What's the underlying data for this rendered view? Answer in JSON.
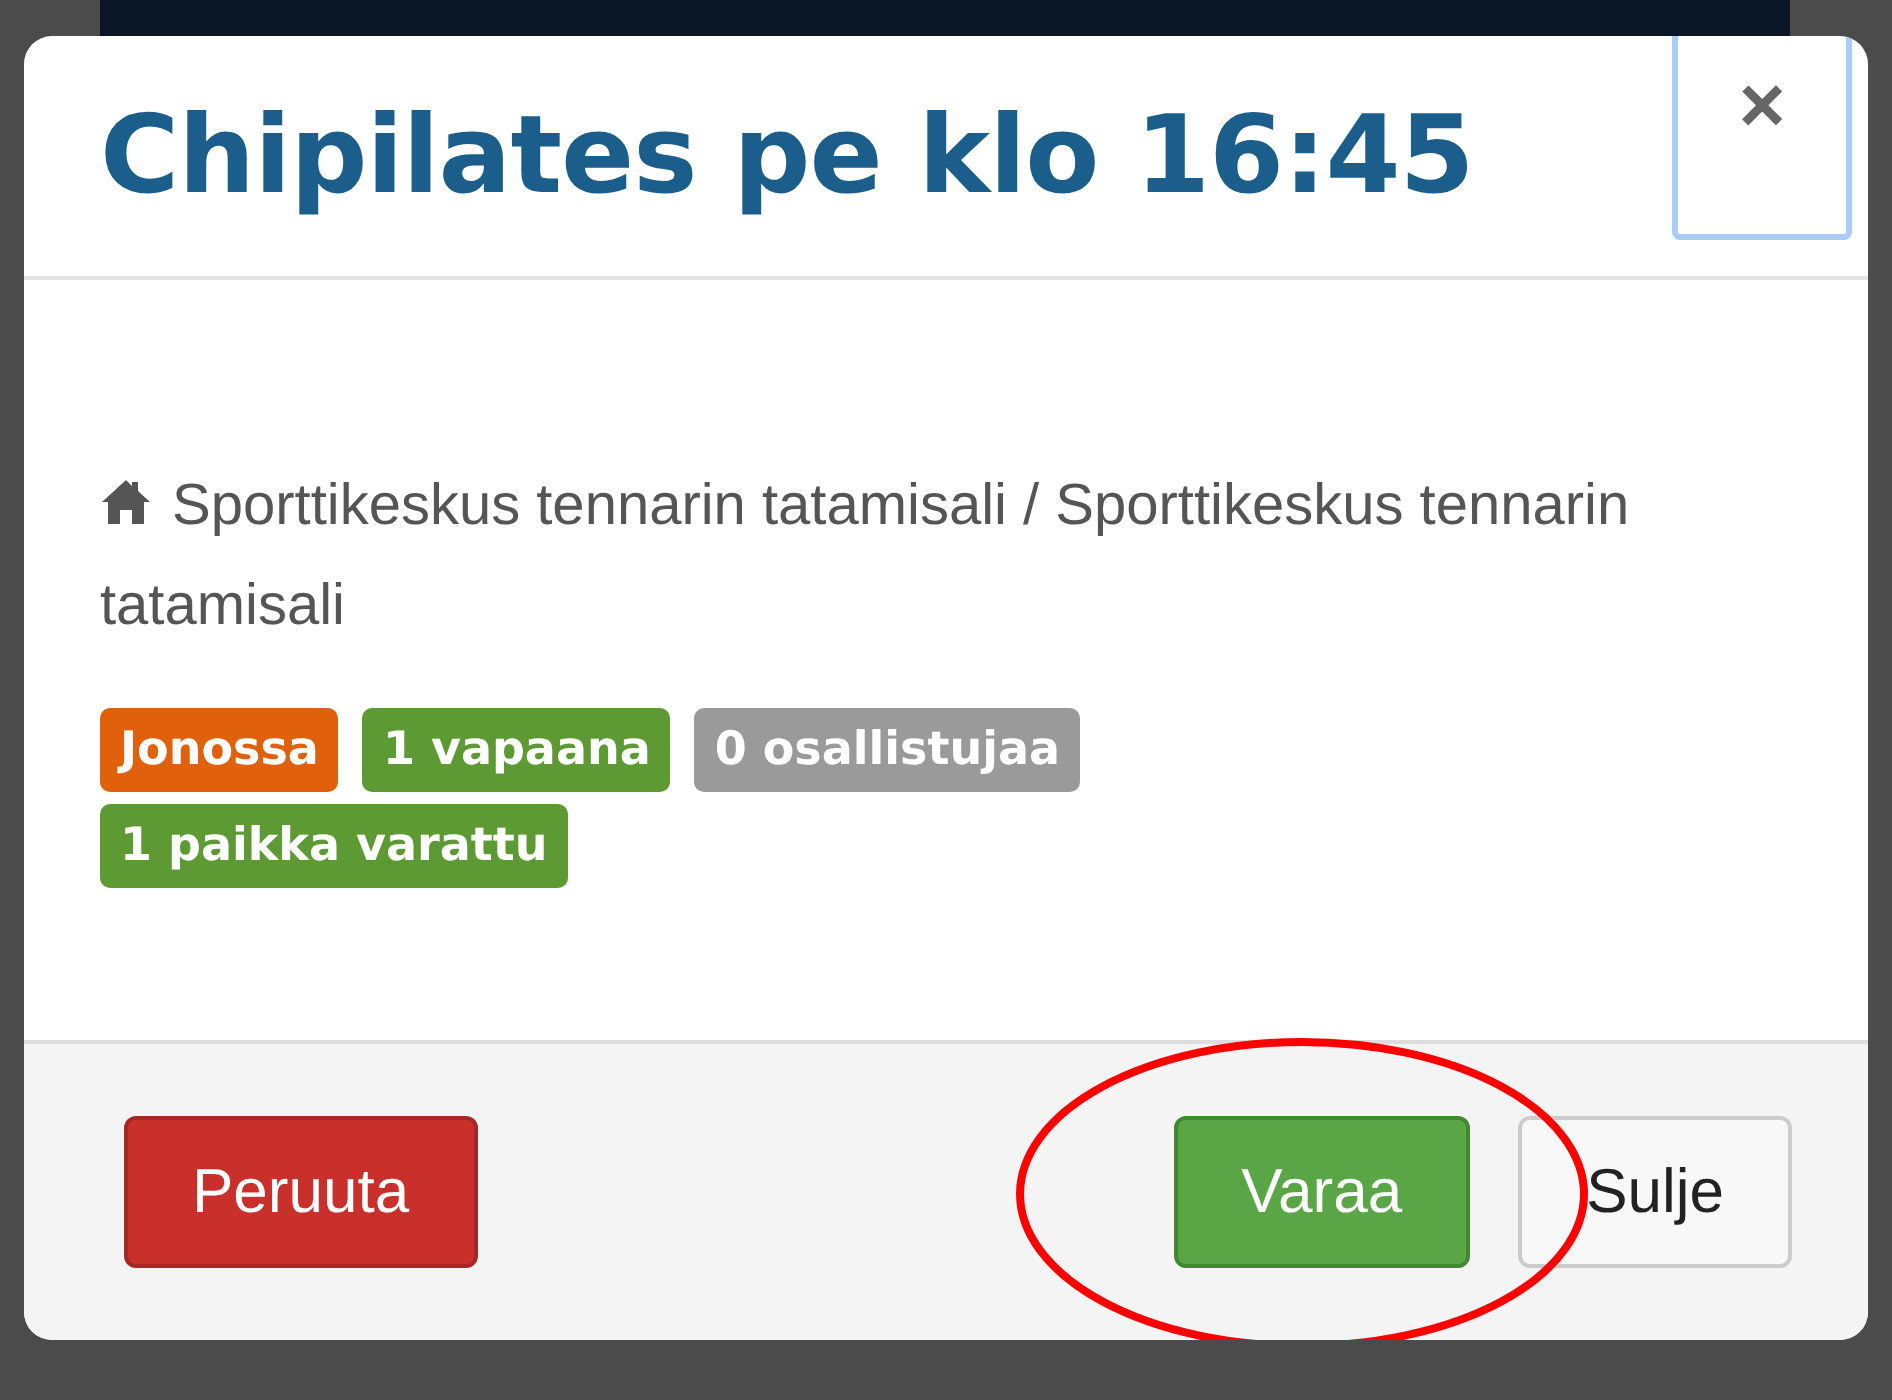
{
  "modal": {
    "title": "Chipilates pe klo 16:45",
    "close": "×",
    "location": "Sporttikeskus tennarin tatamisali / Sporttikeskus tennarin tatamisali",
    "badges": [
      {
        "label": "Jonossa",
        "color": "#e0600c"
      },
      {
        "label": "1 vapaana",
        "color": "#5e9a33"
      },
      {
        "label": "0 osallistujaa",
        "color": "#9a9a9a"
      },
      {
        "label": "1 paikka varattu",
        "color": "#5e9a33"
      }
    ],
    "buttons": [
      {
        "label": "Peruuta",
        "kind": "danger"
      },
      {
        "label": "Varaa",
        "kind": "success",
        "annotated": true
      },
      {
        "label": "Sulje",
        "kind": "default"
      }
    ]
  }
}
